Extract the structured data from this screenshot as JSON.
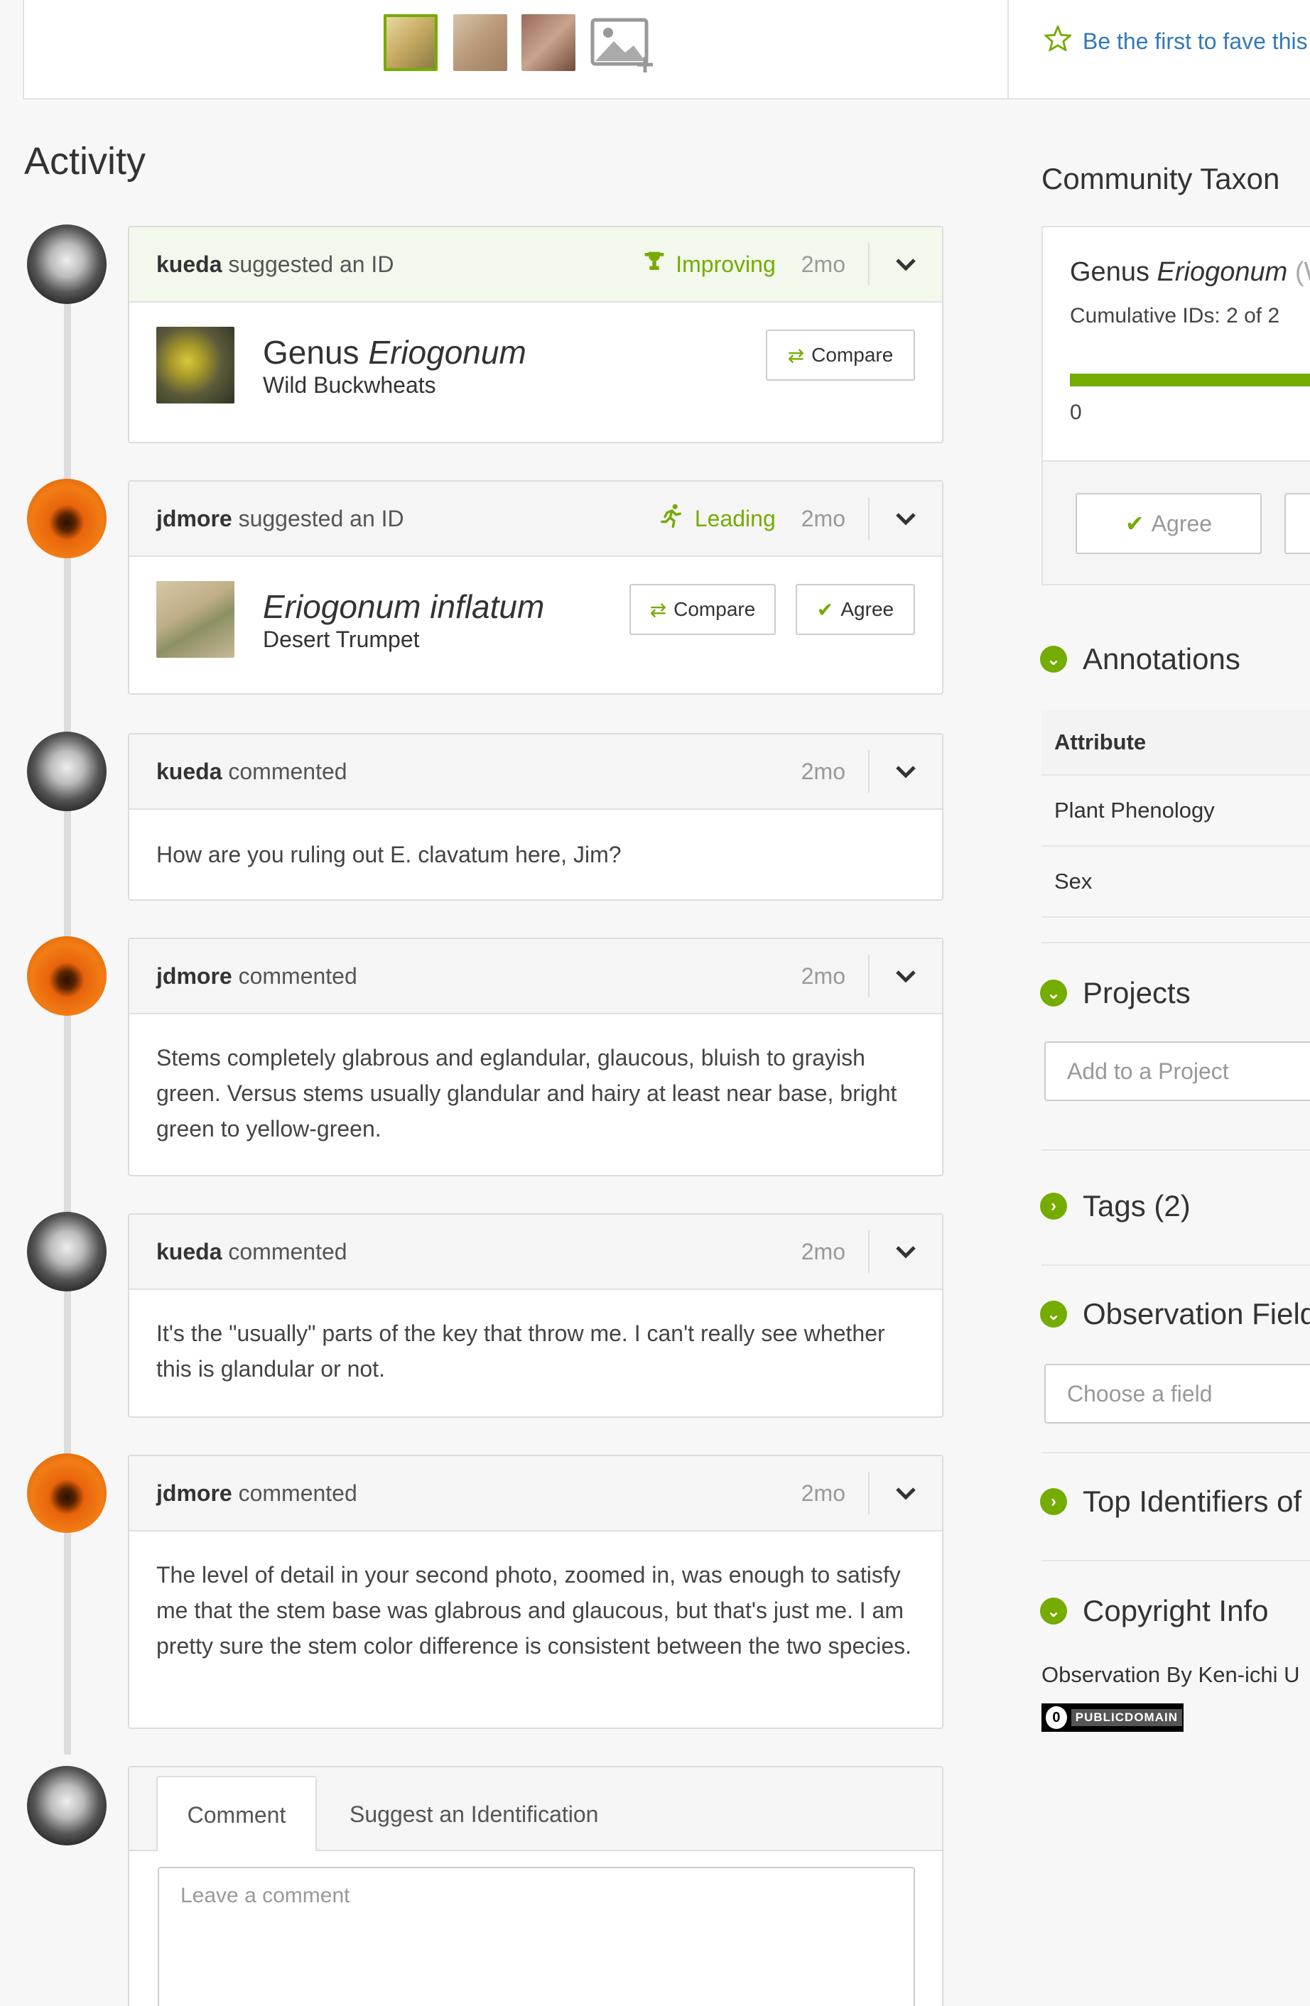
{
  "photos": {
    "thumbs": [
      "photo-thumb-1",
      "photo-thumb-2",
      "photo-thumb-3"
    ],
    "add_icon": "add-photo-icon"
  },
  "fave": {
    "icon": "star-outline-icon",
    "label": "Be the first to fave this"
  },
  "activity": {
    "title": "Activity",
    "items": [
      {
        "user": "kueda",
        "action": "suggested an ID",
        "status": "Improving",
        "status_icon": "trophy-icon",
        "time": "2mo",
        "rank": "Genus",
        "taxon": "Eriogonum",
        "common": "Wild Buckwheats",
        "compare": "Compare"
      },
      {
        "user": "jdmore",
        "action": "suggested an ID",
        "status": "Leading",
        "status_icon": "running-icon",
        "time": "2mo",
        "rank": "",
        "taxon": "Eriogonum inflatum",
        "common": "Desert Trumpet",
        "compare": "Compare",
        "agree": "Agree"
      },
      {
        "user": "kueda",
        "action": "commented",
        "time": "2mo",
        "body": "How are you ruling out E. clavatum here, Jim?"
      },
      {
        "user": "jdmore",
        "action": "commented",
        "time": "2mo",
        "body": "Stems completely glabrous and eglandular, glaucous, bluish to grayish green. Versus stems usually glandular and hairy at least near base, bright green to yellow-green."
      },
      {
        "user": "kueda",
        "action": "commented",
        "time": "2mo",
        "body": "It's the \"usually\" parts of the key that throw me. I can't really see whether this is glandular or not."
      },
      {
        "user": "jdmore",
        "action": "commented",
        "time": "2mo",
        "body": "The level of detail in your second photo, zoomed in, was enough to satisfy me that the stem base was glabrous and glaucous, but that's just me. I am pretty sure the stem color difference is consistent between the two species."
      }
    ],
    "composer": {
      "tab_comment": "Comment",
      "tab_identify": "Suggest an Identification",
      "placeholder": "Leave a comment"
    }
  },
  "community_taxon": {
    "title": "Community Taxon",
    "rank": "Genus",
    "taxon": "Eriogonum",
    "suffix": "(W",
    "cumulative": "Cumulative IDs: 2 of 2",
    "progress_fraction": 1.0,
    "zero": "0",
    "agree": "Agree"
  },
  "annotations": {
    "title": "Annotations",
    "header": "Attribute",
    "rows": [
      "Plant Phenology",
      "Sex"
    ]
  },
  "projects": {
    "title": "Projects",
    "placeholder": "Add to a Project"
  },
  "tags": {
    "title": "Tags (2)"
  },
  "obs_fields": {
    "title": "Observation Field",
    "placeholder": "Choose a field"
  },
  "top_identifiers": {
    "title": "Top Identifiers of"
  },
  "copyright": {
    "title": "Copyright Info",
    "text": "Observation By Ken-ichi U",
    "badge": "PUBLICDOMAIN"
  },
  "colors": {
    "accent": "#74ac00",
    "link": "#337ab7",
    "jdmore": "#f27c14"
  }
}
